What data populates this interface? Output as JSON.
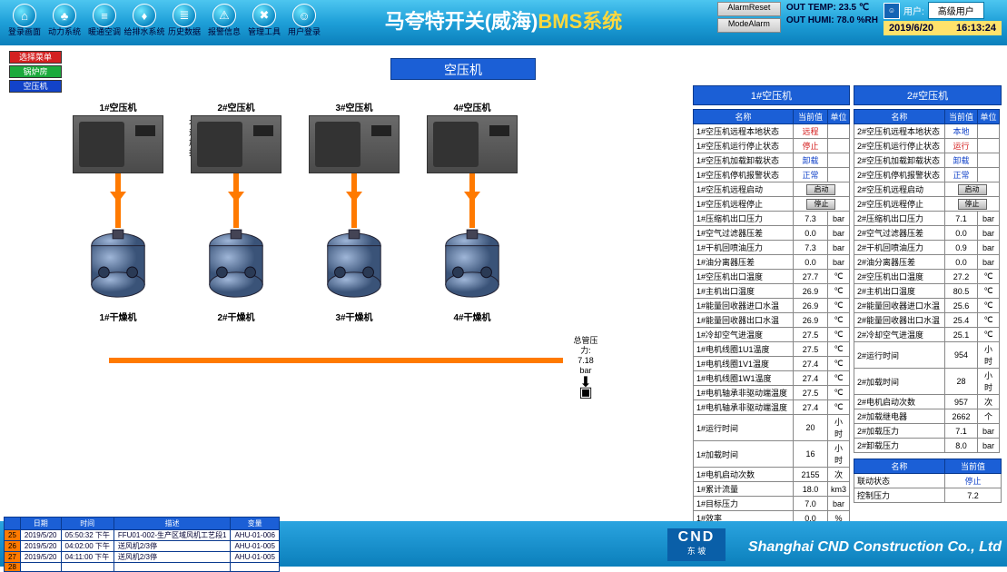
{
  "header": {
    "nav": [
      {
        "icon": "⌂",
        "label": "登录画面"
      },
      {
        "icon": "♣",
        "label": "动力系统"
      },
      {
        "icon": "≡",
        "label": "暖通空调"
      },
      {
        "icon": "♦",
        "label": "给排水系统"
      },
      {
        "icon": "≣",
        "label": "历史数据"
      },
      {
        "icon": "⚠",
        "label": "报警信息"
      },
      {
        "icon": "✖",
        "label": "管理工具"
      },
      {
        "icon": "☺",
        "label": "用户登录"
      }
    ],
    "title_pre": "马夸特开关(威海)",
    "title_tail": "BMS系统",
    "reset1": "AlarmReset",
    "reset2": "ModeAlarm",
    "out_temp_lbl": "OUT TEMP:",
    "out_temp": "23.5 ℃",
    "out_humi_lbl": "OUT HUMI:",
    "out_humi": "78.0 %RH",
    "user_lbl": "用户:",
    "user_val": "高级用户",
    "date": "2019/6/20",
    "time": "16:13:24"
  },
  "side": [
    {
      "cls": "m-red",
      "label": "选择菜单"
    },
    {
      "cls": "m-green",
      "label": "锅炉房"
    },
    {
      "cls": "m-blue",
      "label": "空压机"
    }
  ],
  "center_title": "空压机",
  "legend": {
    "l1": [
      "远程",
      "停止",
      "卸载",
      "正常"
    ],
    "l2": [
      "本地",
      "运行",
      "加载",
      "报警"
    ]
  },
  "units": [
    "1#空压机",
    "2#空压机",
    "3#空压机",
    "4#空压机"
  ],
  "tanks": [
    "1#干燥机",
    "2#干燥机",
    "3#干燥机",
    "4#干燥机"
  ],
  "gauge": {
    "l1": "总管压力:",
    "l2": "7.18",
    "l3": "bar"
  },
  "table1": {
    "title": "1#空压机",
    "headers": [
      "名称",
      "当前值",
      "单位"
    ],
    "rows": [
      [
        "1#空压机远程本地状态",
        "远程",
        "",
        "r"
      ],
      [
        "1#空压机运行停止状态",
        "停止",
        "",
        "r"
      ],
      [
        "1#空压机加载卸载状态",
        "卸载",
        "",
        "b"
      ],
      [
        "1#空压机停机报警状态",
        "正常",
        "",
        "b"
      ],
      [
        "1#空压机远程启动",
        "启动",
        "",
        "btn"
      ],
      [
        "1#空压机远程停止",
        "停止",
        "",
        "btn"
      ],
      [
        "1#压缩机出口压力",
        "7.3",
        "bar",
        "n"
      ],
      [
        "1#空气过滤器压差",
        "0.0",
        "bar",
        "n"
      ],
      [
        "1#干机回喷油压力",
        "7.3",
        "bar",
        "n"
      ],
      [
        "1#油分离器压差",
        "0.0",
        "bar",
        "n"
      ],
      [
        "1#空压机出口温度",
        "27.7",
        "℃",
        "n"
      ],
      [
        "1#主机出口温度",
        "26.9",
        "℃",
        "n"
      ],
      [
        "1#能量回收器进口水温",
        "26.9",
        "℃",
        "n"
      ],
      [
        "1#能量回收器出口水温",
        "26.9",
        "℃",
        "n"
      ],
      [
        "1#冷却空气进温度",
        "27.5",
        "℃",
        "n"
      ],
      [
        "1#电机线圈1U1温度",
        "27.5",
        "℃",
        "n"
      ],
      [
        "1#电机线圈1V1温度",
        "27.4",
        "℃",
        "n"
      ],
      [
        "1#电机线圈1W1温度",
        "27.4",
        "℃",
        "n"
      ],
      [
        "1#电机轴承非驱动端温度",
        "27.5",
        "℃",
        "n"
      ],
      [
        "1#电机轴承非驱动端温度",
        "27.4",
        "℃",
        "n"
      ],
      [
        "1#运行时间",
        "20",
        "小时",
        "n"
      ],
      [
        "1#加载时间",
        "16",
        "小时",
        "n"
      ],
      [
        "1#电机启动次数",
        "2155",
        "次",
        "n"
      ],
      [
        "1#累计流量",
        "18.0",
        "km3",
        "n"
      ],
      [
        "1#目标压力",
        "7.0",
        "bar",
        "n"
      ],
      [
        "1#效率",
        "0.0",
        "%",
        "n"
      ]
    ]
  },
  "table2": {
    "title": "2#空压机",
    "headers": [
      "名称",
      "当前值",
      "单位"
    ],
    "rows": [
      [
        "2#空压机远程本地状态",
        "本地",
        "",
        "b"
      ],
      [
        "2#空压机运行停止状态",
        "运行",
        "",
        "r"
      ],
      [
        "2#空压机加载卸载状态",
        "卸载",
        "",
        "b"
      ],
      [
        "2#空压机停机报警状态",
        "正常",
        "",
        "b"
      ],
      [
        "2#空压机远程启动",
        "启动",
        "",
        "btn"
      ],
      [
        "2#空压机远程停止",
        "停止",
        "",
        "btn"
      ],
      [
        "2#压缩机出口压力",
        "7.1",
        "bar",
        "n"
      ],
      [
        "2#空气过滤器压差",
        "0.0",
        "bar",
        "n"
      ],
      [
        "2#干机回喷油压力",
        "0.9",
        "bar",
        "n"
      ],
      [
        "2#油分离器压差",
        "0.0",
        "bar",
        "n"
      ],
      [
        "2#空压机出口温度",
        "27.2",
        "℃",
        "n"
      ],
      [
        "2#主机出口温度",
        "80.5",
        "℃",
        "n"
      ],
      [
        "2#能量回收器进口水温",
        "25.6",
        "℃",
        "n"
      ],
      [
        "2#能量回收器出口水温",
        "25.4",
        "℃",
        "n"
      ],
      [
        "2#冷却空气进温度",
        "25.1",
        "℃",
        "n"
      ],
      [
        "2#运行时间",
        "954",
        "小时",
        "n"
      ],
      [
        "2#加载时间",
        "28",
        "小时",
        "n"
      ],
      [
        "2#电机启动次数",
        "957",
        "次",
        "n"
      ],
      [
        "2#加载继电器",
        "2662",
        "个",
        "n"
      ],
      [
        "2#加载压力",
        "7.1",
        "bar",
        "n"
      ],
      [
        "2#卸载压力",
        "8.0",
        "bar",
        "n"
      ]
    ]
  },
  "table3": {
    "headers": [
      "名称",
      "当前值"
    ],
    "rows": [
      [
        "联动状态",
        "停止",
        "b"
      ],
      [
        "控制压力",
        "7.2",
        "n"
      ]
    ]
  },
  "alarms": {
    "headers": [
      "",
      "日期",
      "时间",
      "描述",
      "变量"
    ],
    "rows": [
      [
        "25",
        "2019/5/20",
        "05:50:32 下午",
        "FFU01-002-生产区域风机工艺段1",
        "AHU-01-006"
      ],
      [
        "26",
        "2019/5/20",
        "04:02:00 下午",
        "送风机2/3停",
        "AHU-01-005"
      ],
      [
        "27",
        "2019/5/20",
        "04:11:00 下午",
        "送风机2/3停",
        "AHU-01-005"
      ],
      [
        "28",
        "",
        "",
        "",
        ""
      ]
    ]
  },
  "cnd": {
    "big": "CND",
    "small": "东 坡"
  },
  "company": "Shanghai CND Construction Co., Ltd"
}
